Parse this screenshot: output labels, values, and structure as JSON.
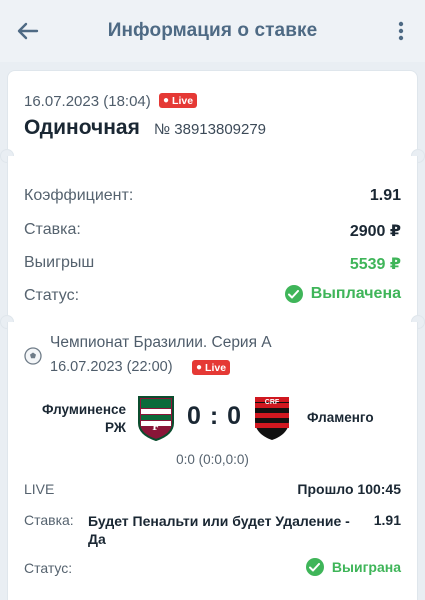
{
  "header": {
    "title": "Информация о ставке",
    "back_icon": "arrow-left-icon",
    "menu_icon": "more-vertical-icon"
  },
  "bet": {
    "date": "16.07.2023 (18:04)",
    "live_badge": "Live",
    "type": "Одиночная",
    "number": "№ 38913809279"
  },
  "details": {
    "odds_label": "Коэффициент:",
    "odds_value": "1.91",
    "stake_label": "Ставка:",
    "stake_value": "2900 ₽",
    "win_label": "Выигрыш",
    "win_value": "5539 ₽",
    "status_label": "Статус:",
    "status_value": "Выплачена"
  },
  "event": {
    "league_icon": "football-icon",
    "league": "Чемпионат Бразилии. Серия А",
    "date": "16.07.2023 (22:00)",
    "live_badge": "Live",
    "home_team_line1": "Флуминенсе",
    "home_team_line2": "РЖ",
    "away_team": "Фламенго",
    "score": "0 : 0",
    "score_detail": "0:0 (0:0,0:0)",
    "live_label": "LIVE",
    "elapsed": "Прошло 100:45",
    "stake_label": "Ставка:",
    "stake_text": "Будет Пенальти или будет Удаление - Да",
    "stake_odds": "1.91",
    "status_label": "Статус:",
    "status_value": "Выиграна"
  },
  "colors": {
    "accent": "#4e6a84",
    "live": "#e53935",
    "success": "#3fb559",
    "background": "#e9eef3"
  }
}
